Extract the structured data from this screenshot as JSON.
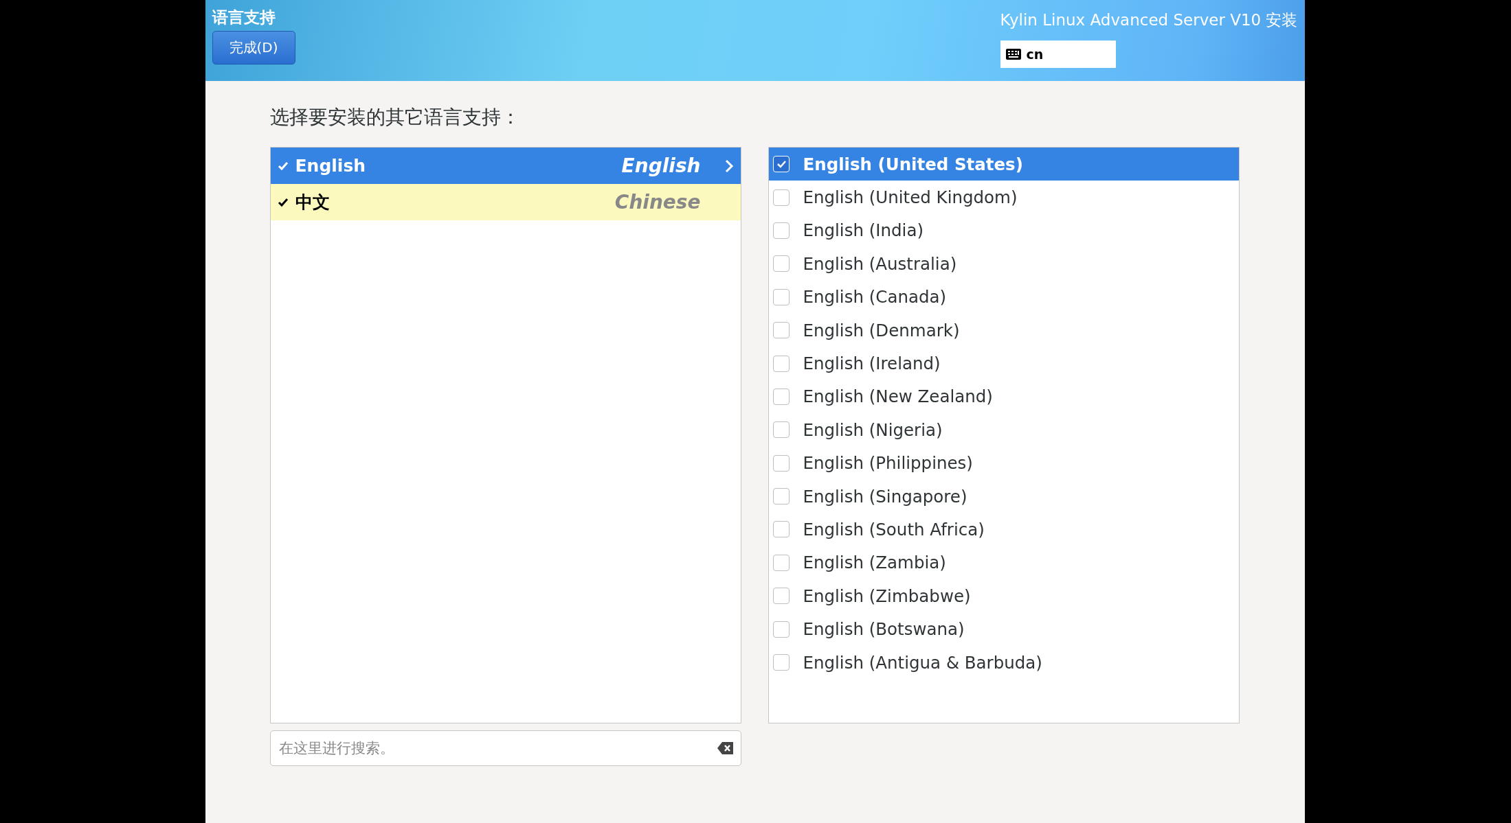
{
  "header": {
    "title": "语言支持",
    "done_button": "完成(D)",
    "product": "Kylin Linux Advanced Server V10 安装",
    "keyboard_layout": "cn"
  },
  "prompt": "选择要安装的其它语言支持：",
  "languages": [
    {
      "native": "English",
      "english": "English",
      "checked": true,
      "selected": true
    },
    {
      "native": "中文",
      "english": "Chinese",
      "checked": true,
      "selected": false
    }
  ],
  "search": {
    "placeholder": "在这里进行搜索。"
  },
  "locales": [
    {
      "label": "English (United States)",
      "checked": true,
      "selected": true
    },
    {
      "label": "English (United Kingdom)",
      "checked": false,
      "selected": false
    },
    {
      "label": "English (India)",
      "checked": false,
      "selected": false
    },
    {
      "label": "English (Australia)",
      "checked": false,
      "selected": false
    },
    {
      "label": "English (Canada)",
      "checked": false,
      "selected": false
    },
    {
      "label": "English (Denmark)",
      "checked": false,
      "selected": false
    },
    {
      "label": "English (Ireland)",
      "checked": false,
      "selected": false
    },
    {
      "label": "English (New Zealand)",
      "checked": false,
      "selected": false
    },
    {
      "label": "English (Nigeria)",
      "checked": false,
      "selected": false
    },
    {
      "label": "English (Philippines)",
      "checked": false,
      "selected": false
    },
    {
      "label": "English (Singapore)",
      "checked": false,
      "selected": false
    },
    {
      "label": "English (South Africa)",
      "checked": false,
      "selected": false
    },
    {
      "label": "English (Zambia)",
      "checked": false,
      "selected": false
    },
    {
      "label": "English (Zimbabwe)",
      "checked": false,
      "selected": false
    },
    {
      "label": "English (Botswana)",
      "checked": false,
      "selected": false
    },
    {
      "label": "English (Antigua & Barbuda)",
      "checked": false,
      "selected": false
    }
  ]
}
